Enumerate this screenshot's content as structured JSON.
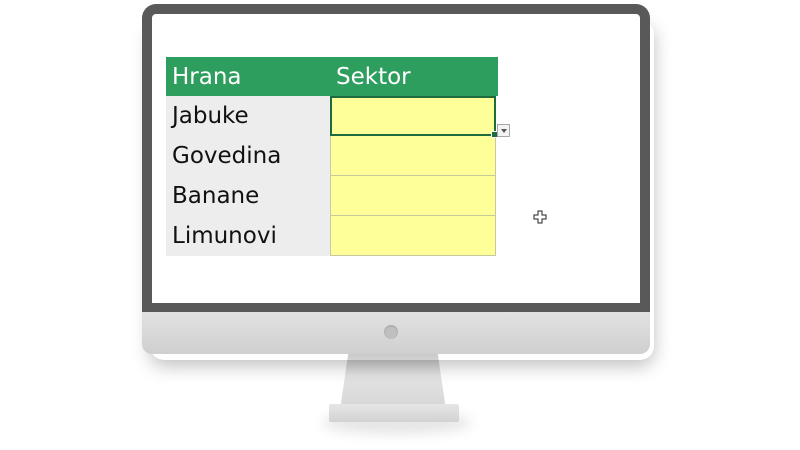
{
  "table": {
    "headers": {
      "food": "Hrana",
      "sector": "Sektor"
    },
    "rows": [
      {
        "food": "Jabuke",
        "sector": ""
      },
      {
        "food": "Govedina",
        "sector": ""
      },
      {
        "food": "Banane",
        "sector": ""
      },
      {
        "food": "Limunovi",
        "sector": ""
      }
    ]
  },
  "colors": {
    "header_bg": "#2e9e5e",
    "input_cell_bg": "#ffff99",
    "active_border": "#1e6b3e",
    "label_cell_bg": "#ededed"
  },
  "icons": {
    "dropdown": "chevron-down-icon",
    "cursor": "plus-cursor-icon"
  }
}
